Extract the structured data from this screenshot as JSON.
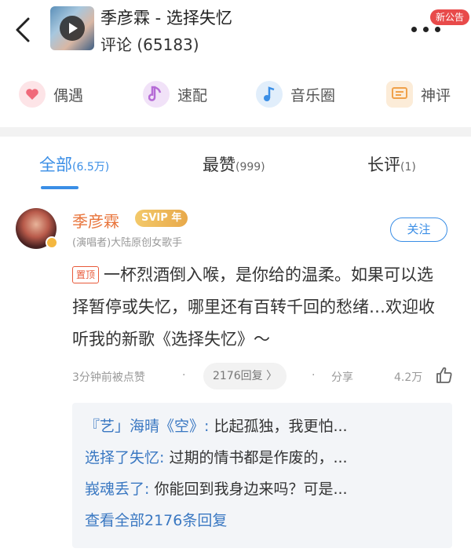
{
  "header": {
    "title": "季彦霖 - 选择失忆",
    "subtitle": "评论 (65183)",
    "notice_badge": "新公告",
    "back_icon": "chevron-left-icon",
    "more_icon": "more-dots-icon"
  },
  "actions": [
    {
      "label": "偶遇",
      "icon": "heart-icon",
      "color": "#f06a7a"
    },
    {
      "label": "速配",
      "icon": "music-note-icon",
      "color": "#b56bd6"
    },
    {
      "label": "音乐圈",
      "icon": "music-note-circle-icon",
      "color": "#3a8ee6"
    },
    {
      "label": "神评",
      "icon": "comment-icon",
      "color": "#f0a14a"
    }
  ],
  "tabs": [
    {
      "label": "全部",
      "count": "(6.5万)",
      "active": true
    },
    {
      "label": "最赞",
      "count": "(999)",
      "active": false
    },
    {
      "label": "长评",
      "count": "(1)",
      "active": false
    }
  ],
  "comment": {
    "username": "季彦霖",
    "vip_badge": "SVIP 年",
    "identity": "(演唱者)大陆原创女歌手",
    "follow_label": "关注",
    "pin_label": "置顶",
    "text": "一杯烈酒倒入喉，是你给的温柔。如果可以选择暂停或失忆，哪里还有百转千回的愁绪…欢迎收听我的新歌《选择失忆》～",
    "time": "3分钟前被点赞",
    "reply_count": "2176回复 〉",
    "share_label": "分享",
    "likes": "4.2万",
    "thumb_icon": "thumbs-up-icon"
  },
  "replies": [
    {
      "who": "『艺」海晴《空》:",
      "text": " 比起孤独，我更怕..."
    },
    {
      "who": "选择了失忆:",
      "text": " 过期的情书都是作废的，..."
    },
    {
      "who": "峩魂丢了:",
      "text": " 你能回到我身边来吗？可是..."
    }
  ],
  "view_all": "查看全部2176条回复",
  "colors": {
    "accent": "#3a8ee6",
    "username": "#e8743b",
    "pin": "#e85a3a",
    "badge": "#e84a4a"
  }
}
